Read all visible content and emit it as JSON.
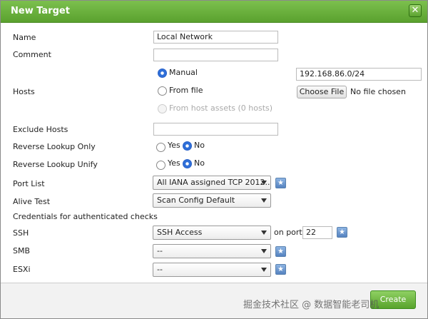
{
  "dialog": {
    "title": "New Target",
    "close_symbol": "✕"
  },
  "form": {
    "name": {
      "label": "Name",
      "value": "Local Network"
    },
    "comment": {
      "label": "Comment",
      "value": ""
    },
    "hosts": {
      "label": "Hosts",
      "manual_label": "Manual",
      "manual_selected": true,
      "manual_value": "192.168.86.0/24",
      "from_file_label": "From file",
      "choose_file_label": "Choose File",
      "no_file_label": "No file chosen",
      "from_assets_label": "From host assets (0 hosts)"
    },
    "exclude_hosts": {
      "label": "Exclude Hosts",
      "value": ""
    },
    "reverse_lookup_only": {
      "label": "Reverse Lookup Only",
      "yes": "Yes",
      "no": "No",
      "selected": "No"
    },
    "reverse_lookup_unify": {
      "label": "Reverse Lookup Unify",
      "yes": "Yes",
      "no": "No",
      "selected": "No"
    },
    "port_list": {
      "label": "Port List",
      "selected": "All IANA assigned TCP 2012..."
    },
    "alive_test": {
      "label": "Alive Test",
      "selected": "Scan Config Default"
    },
    "credentials_heading": "Credentials for authenticated checks",
    "ssh": {
      "label": "SSH",
      "selected": "SSH Access",
      "on_port_label": "on port",
      "port": "22"
    },
    "smb": {
      "label": "SMB",
      "selected": "--"
    },
    "esxi": {
      "label": "ESXi",
      "selected": "--"
    },
    "new_icon": "★"
  },
  "footer": {
    "create_label": "Create",
    "watermark": "掘金技术社区 @ 数据智能老司机"
  },
  "colors": {
    "titlebar": "#5aa12e",
    "accent_radio": "#2f6fd8",
    "star_button": "#5582c0"
  }
}
